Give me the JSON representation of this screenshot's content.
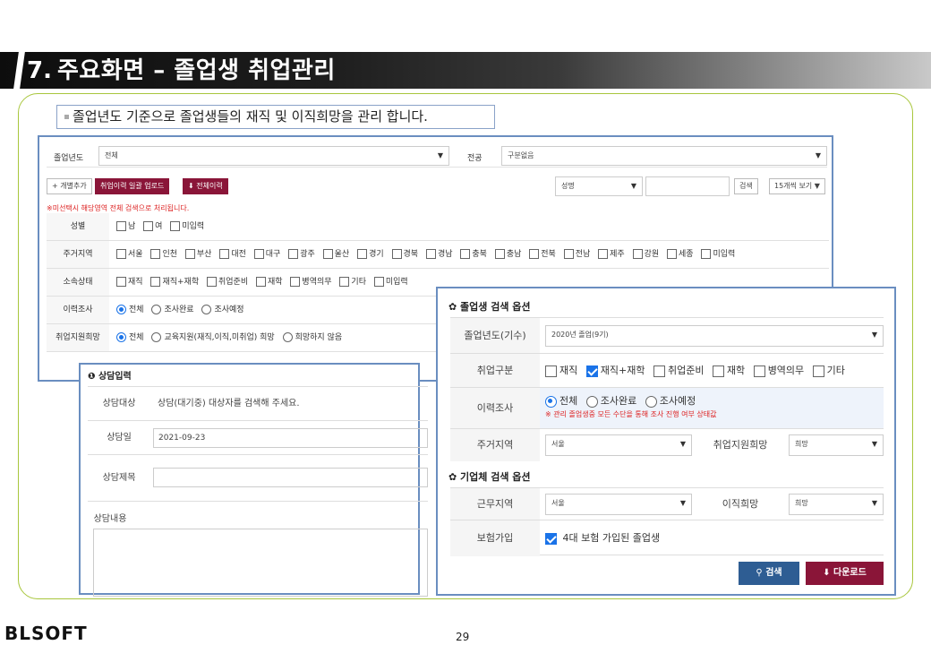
{
  "header": {
    "number": "7.",
    "title": "주요화면 – 졸업생 취업관리"
  },
  "note": "졸업년도 기준으로 졸업생들의 재직 및 이직희망을 관리 합니다.",
  "main": {
    "grad_year_label": "졸업년도",
    "grad_year_value": "전체",
    "major_label": "전공",
    "major_value": "구분없음",
    "btn_add": "+ 개별추가",
    "btn_upload": "취업이력 일괄 업로드",
    "btn_all_history": "전체이력",
    "search_field": "성명",
    "search_button": "검색",
    "per_page": "15개씩 보기",
    "warning": "※미선택시 해당영역 전체 검색으로 처리됩니다.",
    "rows": [
      {
        "label": "성별",
        "options": [
          "남",
          "여",
          "미입력"
        ]
      },
      {
        "label": "주거지역",
        "options": [
          "서울",
          "인천",
          "부산",
          "대전",
          "대구",
          "광주",
          "울산",
          "경기",
          "경북",
          "경남",
          "충북",
          "충남",
          "전북",
          "전남",
          "제주",
          "강원",
          "세종",
          "미입력"
        ]
      },
      {
        "label": "소속상태",
        "options": [
          "재직",
          "재직+재학",
          "취업준비",
          "재학",
          "병역의무",
          "기타",
          "미입력"
        ]
      },
      {
        "label": "이력조사",
        "options": [
          "전체",
          "조사완료",
          "조사예정"
        ]
      },
      {
        "label": "취업지원희망",
        "options": [
          "전체",
          "교육지원(재직,이직,미취업) 희망",
          "희망하지 않음"
        ]
      }
    ]
  },
  "counsel": {
    "title": "상담입력",
    "target_label": "상담대상",
    "target_value": "상담(대기중) 대상자를 검색해 주세요.",
    "date_label": "상담일",
    "date_value": "2021-09-23",
    "subject_label": "상담제목",
    "content_label": "상담내용"
  },
  "search": {
    "grad_section": "졸업생 검색 옵션",
    "grad_year_label": "졸업년도(기수)",
    "grad_year_value": "2020년 졸업(9기)",
    "job_type_label": "취업구분",
    "job_types": [
      "재직",
      "재직+재학",
      "취업준비",
      "재학",
      "병역의무",
      "기타"
    ],
    "survey_label": "이력조사",
    "survey_options": [
      "전체",
      "조사완료",
      "조사예정"
    ],
    "survey_note": "※ 관리 졸업생중 모든 수단을 통해 조사 진행 여부 상태값",
    "region_label": "주거지역",
    "region_value": "서울",
    "support_label": "취업지원희망",
    "support_value": "희망",
    "company_section": "기업체 검색 옵션",
    "work_region_label": "근무지역",
    "work_region_value": "서울",
    "move_label": "이직희망",
    "move_value": "희망",
    "insurance_label": "보험가입",
    "insurance_text": "4대 보험 가입된 졸업생",
    "btn_search": "검색",
    "btn_download": "다운로드"
  },
  "footer": {
    "logo": "BLSOFT",
    "page": "29"
  }
}
